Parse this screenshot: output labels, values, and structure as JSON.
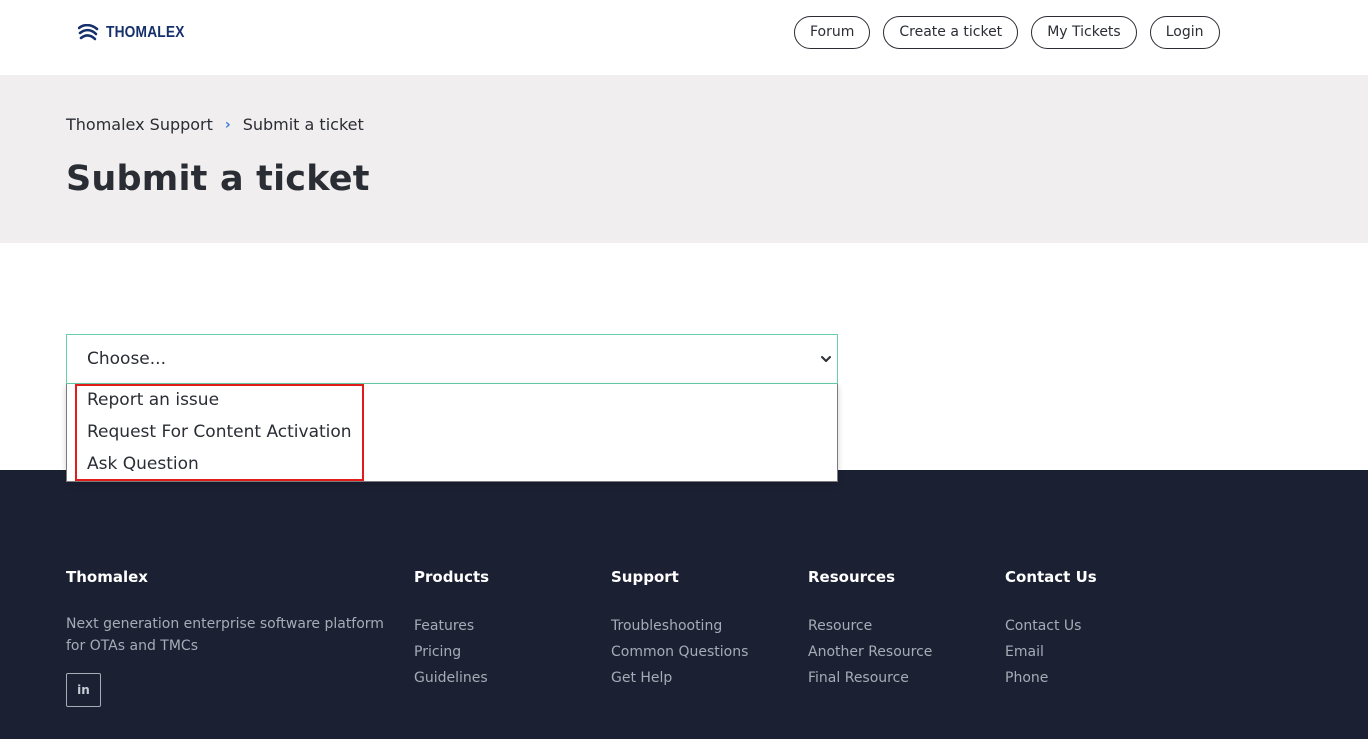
{
  "brand": {
    "name": "THOMALEX",
    "logo_color": "#15306b"
  },
  "nav": {
    "forum": "Forum",
    "create_ticket": "Create a ticket",
    "my_tickets": "My Tickets",
    "login": "Login"
  },
  "breadcrumb": {
    "root": "Thomalex Support",
    "separator": "›",
    "current": "Submit a ticket"
  },
  "page": {
    "title": "Submit a ticket"
  },
  "form": {
    "ticket_type": {
      "selected": "Choose...",
      "options": [
        "Report an issue",
        "Request For Content Activation",
        "Ask Question"
      ],
      "open": true
    }
  },
  "footer": {
    "about": {
      "heading": "Thomalex",
      "description": "Next generation enterprise software platform for OTAs and TMCs",
      "social_icon": "linkedin-icon",
      "social_label": "in"
    },
    "columns": [
      {
        "heading": "Products",
        "links": [
          "Features",
          "Pricing",
          "Guidelines"
        ]
      },
      {
        "heading": "Support",
        "links": [
          "Troubleshooting",
          "Common Questions",
          "Get Help"
        ]
      },
      {
        "heading": "Resources",
        "links": [
          "Resource",
          "Another Resource",
          "Final Resource"
        ]
      },
      {
        "heading": "Contact Us",
        "links": [
          "Contact Us",
          "Email",
          "Phone"
        ]
      }
    ]
  },
  "colors": {
    "hero_bg": "#f0eeee",
    "footer_bg": "#1b2033",
    "select_focus_border": "#69cfa9",
    "highlight_border": "#e21b1b",
    "breadcrumb_separator": "#3a7bd5"
  }
}
